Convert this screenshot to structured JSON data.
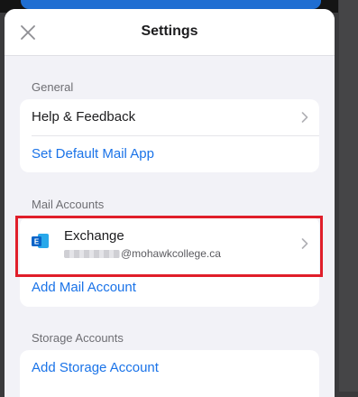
{
  "header": {
    "title": "Settings"
  },
  "sections": {
    "general": {
      "label": "General",
      "help_feedback": "Help & Feedback",
      "set_default_mail_app": "Set Default Mail App"
    },
    "mail_accounts": {
      "label": "Mail Accounts",
      "account_name": "Exchange",
      "account_email_domain": "@mohawkcollege.ca",
      "add_mail_account": "Add Mail Account"
    },
    "storage_accounts": {
      "label": "Storage Accounts",
      "add_storage_account": "Add Storage Account"
    }
  },
  "icons": {
    "close": "close-icon",
    "chevron": "chevron-right-icon",
    "exchange": "exchange-logo-icon"
  },
  "colors": {
    "accent_link": "#1a73e8",
    "highlight_border": "#e01e2a",
    "exchange_logo": "#0a64c8",
    "sheet_background": "#f2f2f7"
  }
}
